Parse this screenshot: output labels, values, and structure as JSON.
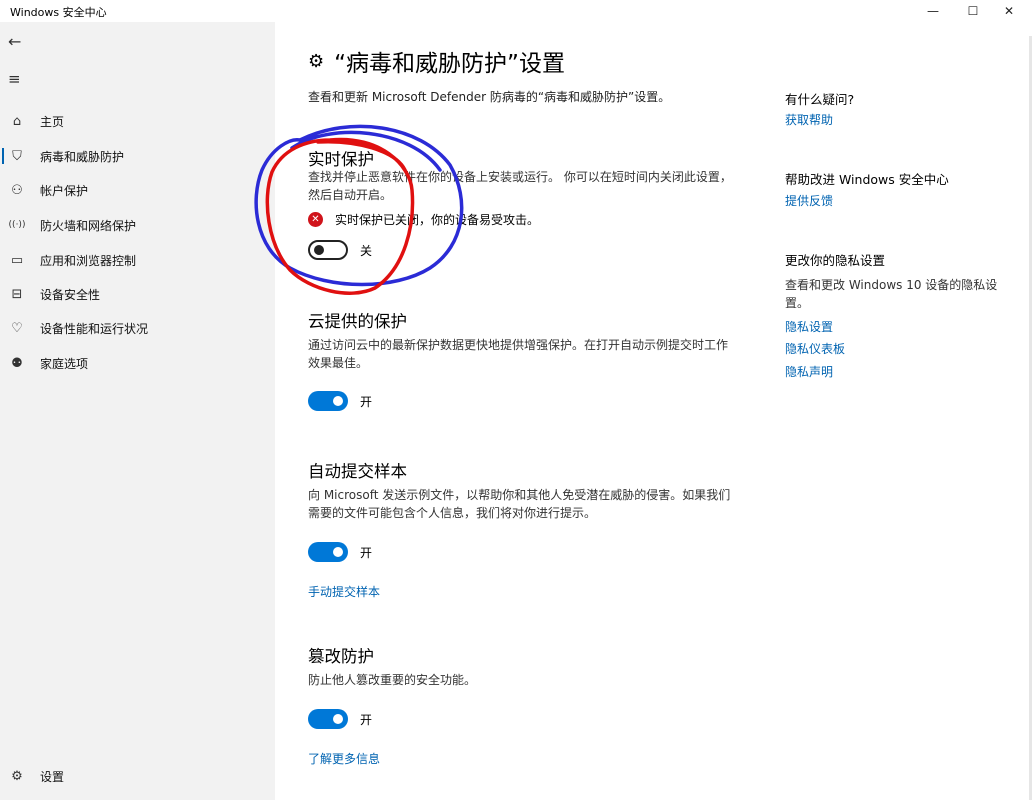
{
  "window": {
    "title": "Windows 安全中心",
    "minimize_glyph": "—",
    "maximize_glyph": "☐",
    "close_glyph": "✕"
  },
  "sidebar": {
    "back_glyph": "←",
    "menu_glyph": "≡",
    "items": [
      {
        "label": "主页",
        "icon": "home-icon",
        "glyph": "⌂"
      },
      {
        "label": "病毒和威胁防护",
        "icon": "shield-icon",
        "glyph": "⛉"
      },
      {
        "label": "帐户保护",
        "icon": "person-icon",
        "glyph": "⚇"
      },
      {
        "label": "防火墙和网络保护",
        "icon": "wifi-icon",
        "glyph": "((·))"
      },
      {
        "label": "应用和浏览器控制",
        "icon": "browser-window-icon",
        "glyph": "▭"
      },
      {
        "label": "设备安全性",
        "icon": "laptop-icon",
        "glyph": "⊟"
      },
      {
        "label": "设备性能和运行状况",
        "icon": "heart-pulse-icon",
        "glyph": "♡"
      },
      {
        "label": "家庭选项",
        "icon": "family-icon",
        "glyph": "⚉"
      }
    ],
    "settings": {
      "label": "设置",
      "icon": "gear-icon",
      "glyph": "⚙"
    }
  },
  "main": {
    "title": "“病毒和威胁防护”设置",
    "title_icon_glyph": "⚙",
    "description": "查看和更新 Microsoft Defender 防病毒的“病毒和威胁防护”设置。",
    "realtime": {
      "title": "实时保护",
      "description": "查找并停止恶意软件在你的设备上安装或运行。 你可以在短时间内关闭此设置，然后自动开启。",
      "warning": "实时保护已关闭，你的设备易受攻击。",
      "toggle_label": "关",
      "enabled": false
    },
    "cloud": {
      "title": "云提供的保护",
      "description": "通过访问云中的最新保护数据更快地提供增强保护。在打开自动示例提交时工作效果最佳。",
      "toggle_label": "开",
      "enabled": true
    },
    "sample": {
      "title": "自动提交样本",
      "description": "向 Microsoft 发送示例文件，以帮助你和其他人免受潜在威胁的侵害。如果我们需要的文件可能包含个人信息，我们将对你进行提示。",
      "toggle_label": "开",
      "enabled": true,
      "link": "手动提交样本"
    },
    "tamper": {
      "title": "篡改防护",
      "description": "防止他人篡改重要的安全功能。",
      "toggle_label": "开",
      "enabled": true,
      "link": "了解更多信息"
    }
  },
  "right": {
    "questions": {
      "title": "有什么疑问?",
      "link": "获取帮助"
    },
    "improve": {
      "title": "帮助改进 Windows 安全中心",
      "link": "提供反馈"
    },
    "privacy": {
      "title": "更改你的隐私设置",
      "text": "查看和更改 Windows 10 设备的隐私设置。",
      "links": [
        "隐私设置",
        "隐私仪表板",
        "隐私声明"
      ]
    }
  },
  "colors": {
    "accent": "#0078d7",
    "link": "#0063b1",
    "error": "#d0141b",
    "sidebar_bg": "#f2f2f2",
    "annotation_blue": "#2b2bd6",
    "annotation_red": "#e01010"
  }
}
